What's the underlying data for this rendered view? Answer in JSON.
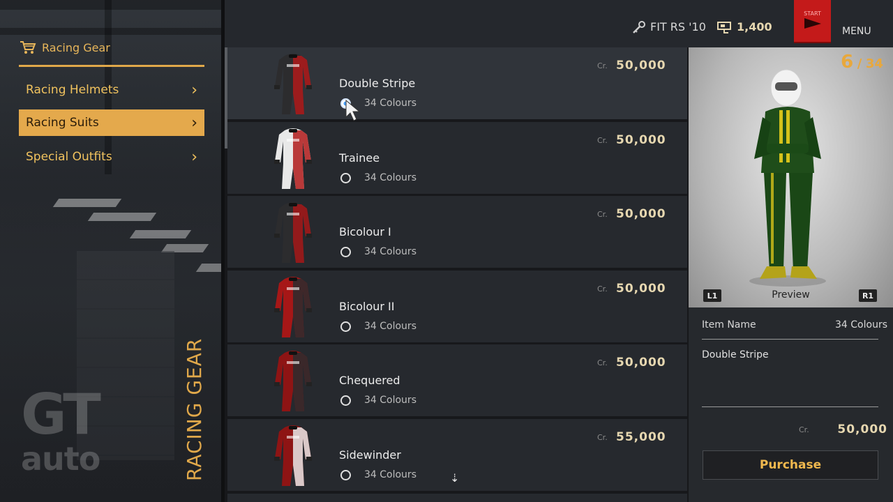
{
  "sidebar": {
    "category": "Racing Gear",
    "items": [
      {
        "label": "Racing Helmets",
        "active": false
      },
      {
        "label": "Racing Suits",
        "active": true
      },
      {
        "label": "Special Outfits",
        "active": false
      }
    ],
    "section_title": "RACING GEAR",
    "logo_top": "GT",
    "logo_bottom": "auto"
  },
  "topbar": {
    "car": "FIT RS '10",
    "credits": "1,400",
    "start_label": "START",
    "menu_label": "MENU"
  },
  "list": {
    "currency": "Cr.",
    "items": [
      {
        "name": "Double Stripe",
        "colours": "34 Colours",
        "price": "50,000",
        "suit_colors": [
          "#2c2c2e",
          "#b01a1a"
        ],
        "selected": true
      },
      {
        "name": "Trainee",
        "colours": "34 Colours",
        "price": "50,000",
        "suit_colors": [
          "#e8e8e8",
          "#b01a1a"
        ],
        "selected": false
      },
      {
        "name": "Bicolour I",
        "colours": "34 Colours",
        "price": "50,000",
        "suit_colors": [
          "#2c2c2e",
          "#a61717"
        ],
        "selected": false
      },
      {
        "name": "Bicolour II",
        "colours": "34 Colours",
        "price": "50,000",
        "suit_colors": [
          "#a61717",
          "#2c2c2e"
        ],
        "selected": false
      },
      {
        "name": "Chequered",
        "colours": "34 Colours",
        "price": "50,000",
        "suit_colors": [
          "#8e1414",
          "#2c2c2e"
        ],
        "selected": false
      },
      {
        "name": "Sidewinder",
        "colours": "34 Colours",
        "price": "55,000",
        "suit_colors": [
          "#8e1414",
          "#e8e8e8"
        ],
        "selected": false
      }
    ]
  },
  "preview": {
    "current": "6",
    "separator": "/",
    "total": "34",
    "left_key": "L1",
    "right_key": "R1",
    "label": "Preview",
    "info_label": "Item Name",
    "info_value": "34 Colours",
    "item_name": "Double Stripe",
    "currency": "Cr.",
    "price": "50,000",
    "purchase_label": "Purchase"
  },
  "colors": {
    "accent": "#e4a94c",
    "price": "#e6d7b0",
    "start_red": "#c41a1a"
  }
}
